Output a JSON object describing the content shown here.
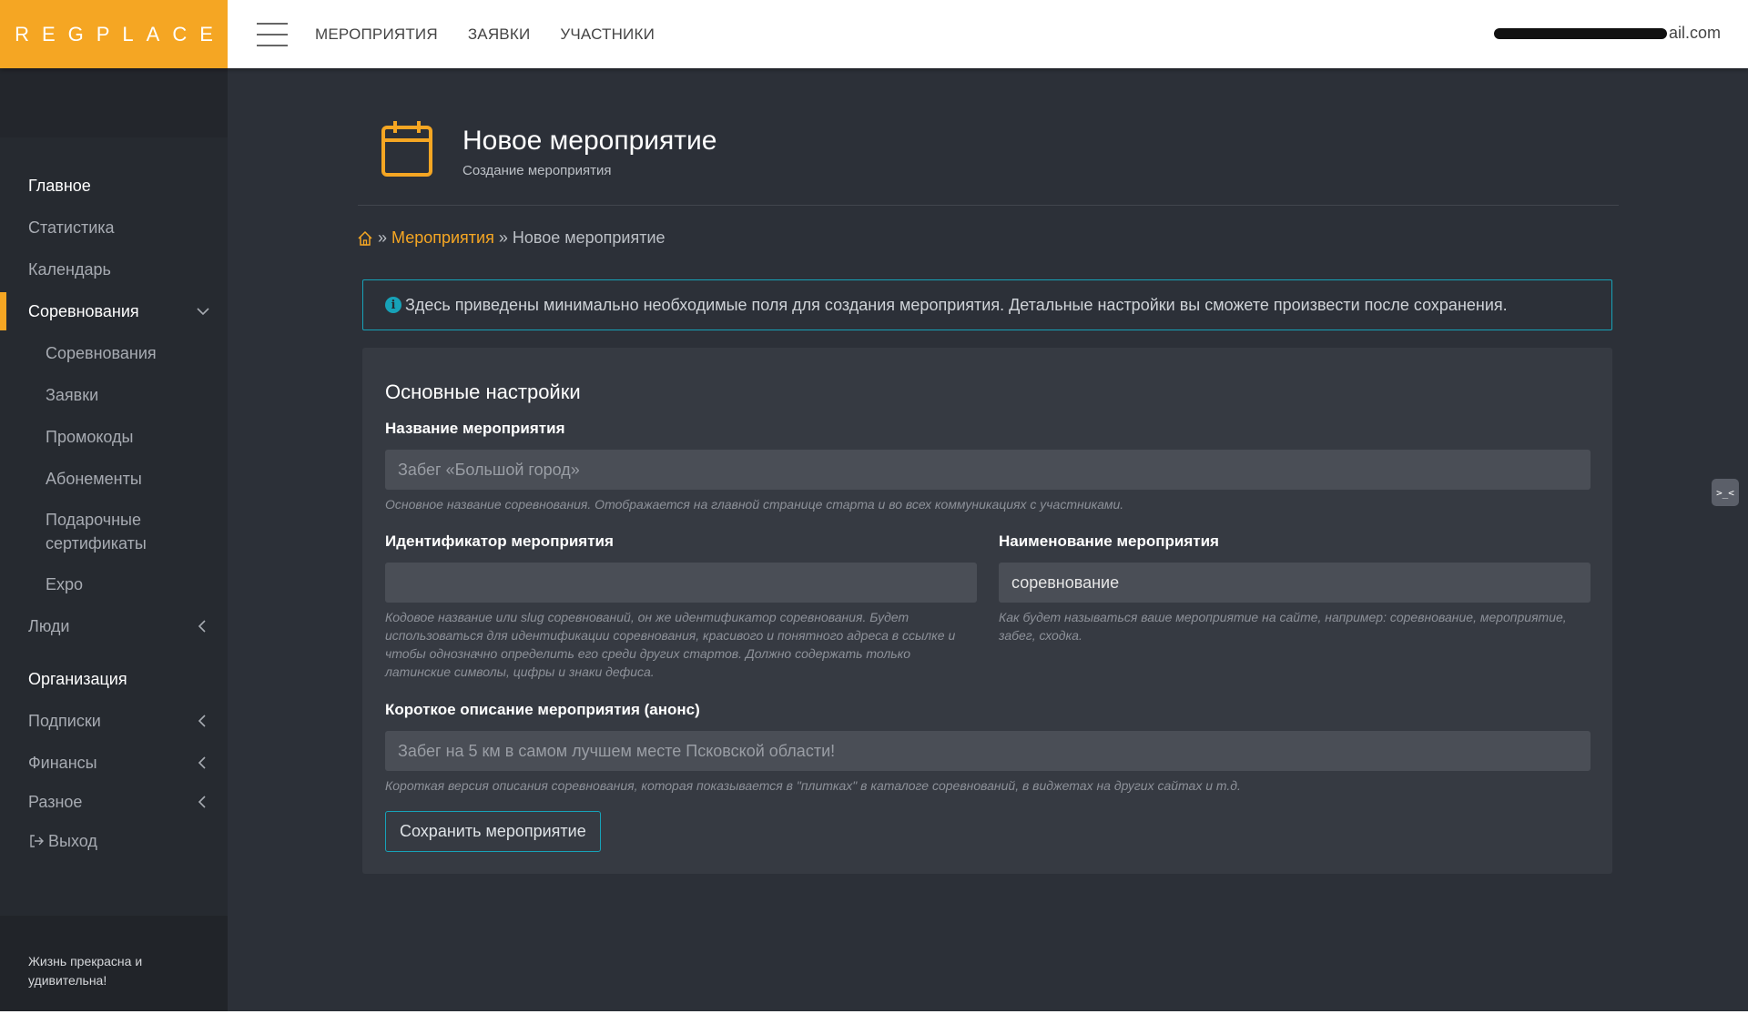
{
  "brand": "REGPLACE",
  "topnav": [
    "МЕРОПРИЯТИЯ",
    "ЗАЯВКИ",
    "УЧАСТНИКИ"
  ],
  "user_email_visible": "ail.com",
  "sidebar": {
    "items": [
      {
        "label": "Главное",
        "type": "section"
      },
      {
        "label": "Статистика",
        "type": "item"
      },
      {
        "label": "Календарь",
        "type": "item"
      },
      {
        "label": "Соревнования",
        "type": "item",
        "active": true,
        "chevron": "down"
      },
      {
        "label": "Соревнования",
        "type": "sub"
      },
      {
        "label": "Заявки",
        "type": "sub"
      },
      {
        "label": "Промокоды",
        "type": "sub"
      },
      {
        "label": "Абонементы",
        "type": "sub"
      },
      {
        "label": "Подарочные сертификаты",
        "type": "sub"
      },
      {
        "label": "Expo",
        "type": "sub"
      },
      {
        "label": "Люди",
        "type": "item",
        "chevron": "left"
      },
      {
        "label": "Организация",
        "type": "section"
      },
      {
        "label": "Подписки",
        "type": "item",
        "chevron": "left"
      },
      {
        "label": "Финансы",
        "type": "item",
        "chevron": "left"
      },
      {
        "label": "Разное",
        "type": "item",
        "chevron": "left"
      },
      {
        "label": "Выход",
        "type": "item",
        "icon": "logout-icon"
      }
    ],
    "footer": "Жизнь прекрасна и удивительна!"
  },
  "page": {
    "title": "Новое мероприятие",
    "subtitle": "Создание мероприятия",
    "icon": "calendar-icon"
  },
  "breadcrumb": {
    "home_icon": "home-icon",
    "sep": "»",
    "link": "Мероприятия",
    "current": "Новое мероприятие"
  },
  "alert": {
    "icon": "info-icon",
    "text": "Здесь приведены минимально необходимые поля для создания мероприятия. Детальные настройки вы сможете произвести после сохранения."
  },
  "form": {
    "section_title": "Основные настройки",
    "name": {
      "label": "Название мероприятия",
      "placeholder": "Забег «Большой город»",
      "hint": "Основное название соревнования. Отображается на главной странице старта и во всех коммуникациях с участниками."
    },
    "slug": {
      "label": "Идентификатор мероприятия",
      "value": "",
      "hint": "Кодовое название или slug соревнований, он же идентификатор соревнования. Будет использоваться для идентификации соревнования, красивого и понятного адреса в ссылке и чтобы однозначно определить его среди других стартов. Должно содержать только латинские символы, цифры и знаки дефиса."
    },
    "type_name": {
      "label": "Наименование мероприятия",
      "value": "соревнование",
      "hint": "Как будет называться ваше мероприятие на сайте, например: соревнование, мероприятие, забег, сходка."
    },
    "short_desc": {
      "label": "Короткое описание мероприятия (анонс)",
      "placeholder": "Забег на 5 км в самом лучшем месте Псковской области!",
      "hint": "Короткая версия описания соревнования, которая показывается в \"плитках\" в каталоге соревнований, в виджетах на других сайтах и т.д."
    },
    "save_label": "Сохранить мероприятие"
  },
  "widget_label": ">_<",
  "colors": {
    "accent": "#f5a623",
    "info": "#17a2b8",
    "background": "#2c3038",
    "sidebar": "#262a30"
  }
}
